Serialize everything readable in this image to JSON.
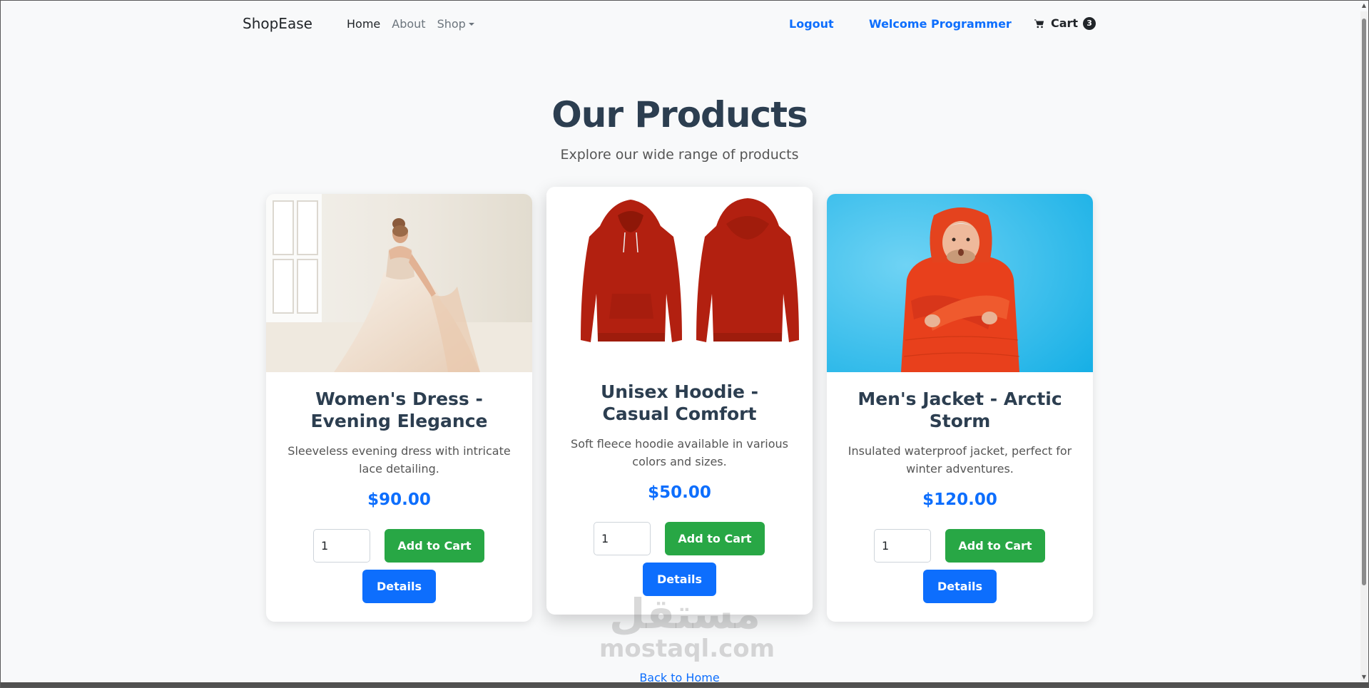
{
  "navbar": {
    "brand": "ShopEase",
    "links": [
      {
        "label": "Home",
        "active": true
      },
      {
        "label": "About",
        "active": false
      },
      {
        "label": "Shop",
        "active": false
      }
    ],
    "logout": "Logout",
    "welcome": "Welcome Programmer",
    "cart_label": "Cart",
    "cart_count": "3"
  },
  "header": {
    "title": "Our Products",
    "subtitle": "Explore our wide range of products"
  },
  "products": [
    {
      "name": "Women's Dress - Evening Elegance",
      "description": "Sleeveless evening dress with intricate lace detailing.",
      "price": "$90.00",
      "quantity": "1",
      "add_to_cart": "Add to Cart",
      "details": "Details",
      "image_icon": "dress-photo"
    },
    {
      "name": "Unisex Hoodie - Casual Comfort",
      "description": "Soft fleece hoodie available in various colors and sizes.",
      "price": "$50.00",
      "quantity": "1",
      "add_to_cart": "Add to Cart",
      "details": "Details",
      "image_icon": "hoodie-photo"
    },
    {
      "name": "Men's Jacket - Arctic Storm",
      "description": "Insulated waterproof jacket, perfect for winter adventures.",
      "price": "$120.00",
      "quantity": "1",
      "add_to_cart": "Add to Cart",
      "details": "Details",
      "image_icon": "jacket-photo"
    }
  ],
  "footer": {
    "back_link": "Back to Home"
  },
  "watermark": {
    "arabic": "مستقل",
    "latin": "mostaql.com"
  },
  "colors": {
    "primary": "#0d6efd",
    "success": "#28a745",
    "title": "#2c3e50",
    "background": "#f8f9fa"
  }
}
